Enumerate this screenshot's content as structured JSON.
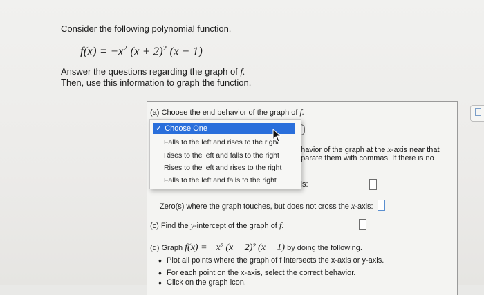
{
  "intro": "Consider the following polynomial function.",
  "formula": {
    "fx": "f(x) = −x",
    "exp1": "2",
    "mid": " (x + 2)",
    "exp2": "2",
    "tail": " (x − 1)"
  },
  "instructions": {
    "line1_prefix": "Answer the questions regarding the graph of ",
    "line1_f": "f.",
    "line2": "Then, use this information to graph the function."
  },
  "part_a": {
    "label_prefix": "(a) Choose the end behavior of the graph of ",
    "label_f": "f.",
    "dropdown": {
      "selected": "Choose One",
      "options": [
        "Falls to the left and rises to the right",
        "Rises to the left and falls to the right",
        "Rises to the left and rises to the right",
        "Falls to the left and falls to the right"
      ]
    }
  },
  "part_b": {
    "partial_line1_pre": "ehavior of the graph at the ",
    "partial_line1_x": "x",
    "partial_line1_post": "-axis near that",
    "partial_line2": "eparate them with commas. If there is no",
    "partial_line3": "xis:",
    "touch_label_pre": "Zero(s) where the graph touches, but does not cross the ",
    "touch_label_x": "x",
    "touch_label_post": "-axis:"
  },
  "part_c": {
    "label_pre": "(c) Find the ",
    "label_y": "y",
    "label_mid": "-intercept of the graph of ",
    "label_f": "f:"
  },
  "part_d": {
    "label_pre": "(d) Graph ",
    "formula": "f(x) = −x² (x + 2)² (x − 1)",
    "label_post": " by doing the following.",
    "bullets": [
      "Plot all points where the graph of f intersects the x-axis or y-axis.",
      "For each point on the x-axis, select the correct behavior.",
      "Click on the graph icon."
    ]
  },
  "colors": {
    "accent": "#2a6fdb",
    "input_border": "#6d6d6d",
    "answer_blue": "#5a8fd0"
  }
}
